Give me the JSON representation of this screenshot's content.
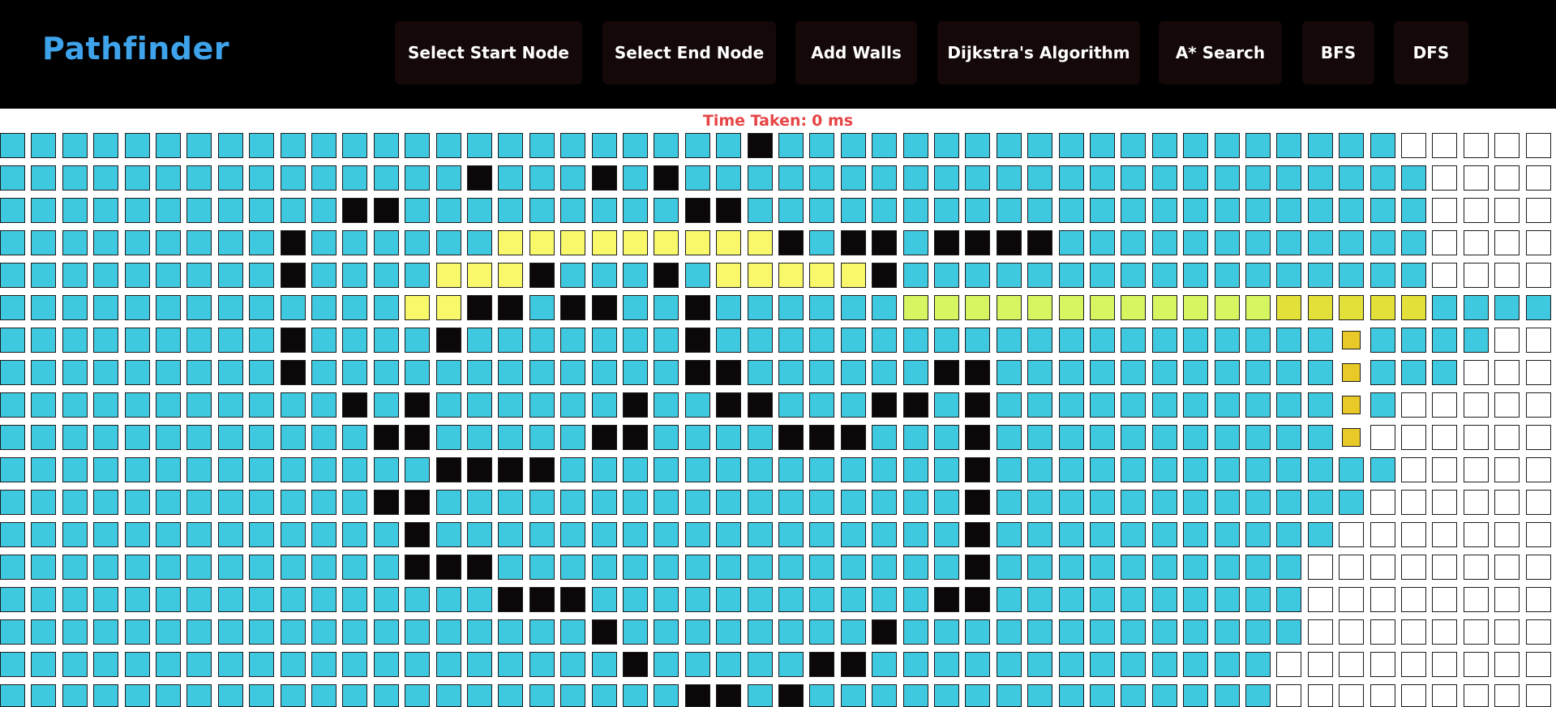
{
  "app_title": "Pathfinder",
  "nav": {
    "buttons": [
      {
        "id": "select-start",
        "label": "Select Start Node"
      },
      {
        "id": "select-end",
        "label": "Select End Node"
      },
      {
        "id": "add-walls",
        "label": "Add Walls"
      },
      {
        "id": "dijkstra",
        "label": "Dijkstra's Algorithm"
      },
      {
        "id": "astar",
        "label": "A* Search"
      },
      {
        "id": "bfs",
        "label": "BFS"
      },
      {
        "id": "dfs",
        "label": "DFS"
      }
    ]
  },
  "stats": {
    "time_label": "Time Taken:",
    "time_value": "0 ms"
  },
  "colors": {
    "background": "#ffffff",
    "navbar": "#000000",
    "brand": "#3ea3ea",
    "button": "#140808",
    "timer": "#e64545",
    "visited": "#3ec9e0",
    "wall": "#0c0809",
    "path": "#f8f86a",
    "path_highlight": "#d6f560",
    "unvisited": "#ffffff"
  },
  "grid": {
    "rows": 19,
    "cols": 50,
    "row_data": [
      "vvvvvvvvvvvvvvvvvvvvvvvvwvvvvvvvvvvvvvvvvvvvvuuuuu",
      "vvvvvvvvvvvvvvvwvvvwvwvvvvvvvvvvvvvvvvvvvvvvvvuuuu",
      "vvvvvvvvvvvwwvvvvvvvvvwwvvvvvvvvvvvvvvvvvvvvvvuuuu",
      "vvvvvvvvvwvvvvvvpppppppppwvwwvwwwwvvvvvvvvvvvvuuuu",
      "vvvvvvvvvwvvvvpppwvvvwvpppppwvvvvvvvvvvvvvvvvvuuuu",
      "vvvvvvvvvvvvvppwwvwwvvwvvvvvvggggggggggggcccccvvvvuuuu",
      "vvvvvvvvvwvvvvwvvvvvvvwvvvvvvvvvvvvvvvvvvvvsvvvvuuu",
      "vvvvvvvvvwvvvvvvvvvvvvwwvvvvvvwwvvvvvvvvvvvsvvvuuuu",
      "vvvvvvvvvvvwvwvvvvvvwvvwwvvvwwvwvvvvvvvvvvvsvuuuuu",
      "vvvvvvvvvvvvwwvvvvvwwvvvvwwwvvvwvvvvvvvvvvvsuuuuuu",
      "vvvvvvvvvvvvvvwwwwvvvvvvvvvvvvvwvvvvvvvvvvvvvuuuuuu",
      "vvvvvvvvvvvvwwvvvvvvvvvvvvvvvvvwvvvvvvvvvvvvuuuuuu",
      "vvvvvvvvvvvvvwvvvvvvvvvvvvvvvvvwvvvvvvvvvvvuuuuuuu",
      "vvvvvvvvvvvvvwwwvvvvvvvvvvvvvvvwvvvvvvvvvvuuuuuuuu",
      "vvvvvvvvvvvvvvvvwwwvvvvvvvvvvvwwvvvvvvvvvvuuuuuuuu",
      "vvvvvvvvvvvvvvvvvvvwvvvvvvvvwvvvvvvvvvvvvvuuuuuuuu",
      "vvvvvvvvvvvvvvvvvvvvwvvvvvwwvvvvvvvvvvvvvuuuuuuuuu",
      "vvvvvvvvvvvvvvvvvvvvvvwwvwvvvvvvvvvvvvvvvuuuuuuuuu",
      "vvvvvvvvvvvvvvvvvvvvvvvvvvvvvvvvvvvvvvvvuuuuuuuuuu"
    ]
  }
}
